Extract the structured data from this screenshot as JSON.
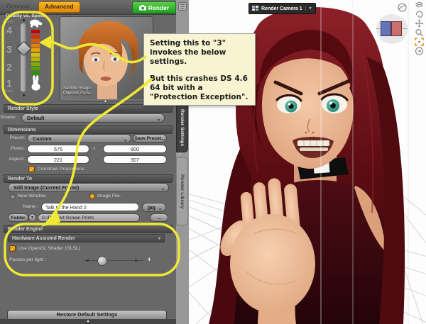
{
  "colors": {
    "accent_orange": "#e8920c",
    "render_green": "#2eb82e",
    "annotation_yellow": "#f0e832",
    "callout_bg": "#f8f3d0",
    "panel_bg": "#686868",
    "gradient": [
      "#c40000",
      "#d63000",
      "#e05800",
      "#e67e00",
      "#eaa200",
      "#dfc000",
      "#b3b700",
      "#85ab00",
      "#57a000",
      "#2f9200"
    ]
  },
  "panel": {
    "tabs": {
      "general": "General",
      "advanced": "Advanced"
    },
    "render_button_label": "Render",
    "quality": {
      "title": "Quality vs. Speed",
      "top_small_label": "Best",
      "bottom_small_label": "Fast",
      "levels": [
        "4",
        "3",
        "2",
        "1"
      ],
      "current_level": "3",
      "sample_caption1": "Sample Image:",
      "sample_caption2": "OpenGL GLSL"
    },
    "render_style": {
      "header": "Render Style",
      "shader_label": "Shader :",
      "shader_value": "Default"
    },
    "dimensions": {
      "header": "Dimensions",
      "preset_label": "Preset:",
      "preset_value": "Custom",
      "save_preset_label": "Save Preset...",
      "pixels_label": "Pixels:",
      "pixels_width": "575",
      "pixels_sep": "x",
      "pixels_height": "800",
      "aspect_label": "Aspect:",
      "aspect_width": "221",
      "aspect_sep": ":",
      "aspect_height": "307",
      "constrain_label": "Constrain Proportions"
    },
    "render_to": {
      "header": "Render To",
      "target_value": "Still Image (Current Frame)",
      "new_window_label": "New Window",
      "image_file_label": "Image File :",
      "name_label": "Name :",
      "name_value": "Talk to the Hand 2",
      "format_value": "jpg",
      "folder_button_label": "Folder",
      "folder_value": "G:/DAZ Art Screen Prints",
      "browse_label": "..."
    },
    "render_engine_header": "Render Engine",
    "hardware": {
      "header": "Hardware Assisted Render",
      "use_opengl_label": "Use OpenGL Shader (GLSL)",
      "passes_label": "Passes per light :",
      "passes_value": "4"
    },
    "restore_button_label": "Restore Default Settings"
  },
  "side_tabs": {
    "render_settings": "Render Settings",
    "render_library": "Render Library"
  },
  "viewport": {
    "camera_label": "Render Camera 1",
    "tool_icons": [
      "layers-icon",
      "rotate-view-icon",
      "pan-view-icon",
      "zoom-dolly-icon",
      "frame-item-icon",
      "reset-view-icon"
    ],
    "nav_icons": [
      "aim-sphere-icon",
      "view-cube"
    ]
  },
  "callout": {
    "para1": "Setting this to \"3\" invokes the below settings.",
    "para2": "But this crashes DS 4.6 64 bit with a \"Protection Exception\"."
  }
}
